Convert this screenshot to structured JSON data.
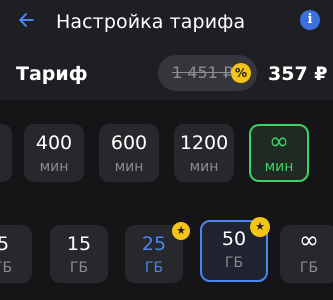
{
  "header": {
    "title": "Настройка тарифа",
    "info_label": "i"
  },
  "tariff": {
    "label": "Тариф",
    "old_price": "1 451 ₽",
    "discount_symbol": "%",
    "new_price": "357 ₽"
  },
  "minutes": {
    "unit": "мин",
    "options": [
      {
        "value": "400"
      },
      {
        "value": "600"
      },
      {
        "value": "1200"
      },
      {
        "value": "∞",
        "selected": true
      }
    ]
  },
  "gigabytes": {
    "unit": "ГБ",
    "options": [
      {
        "value": "5"
      },
      {
        "value": "15"
      },
      {
        "value": "25",
        "badge": "star",
        "accent": true
      },
      {
        "value": "50",
        "badge": "star",
        "selected": true
      },
      {
        "value": "∞"
      }
    ]
  },
  "icons": {
    "back": "arrow-left-icon",
    "info": "info-icon",
    "discount": "percent-icon",
    "badge": "star-icon"
  },
  "colors": {
    "accent_blue": "#4a86ef",
    "accent_green": "#3fd06a",
    "badge_yellow": "#f4c418",
    "background": "#151518"
  }
}
